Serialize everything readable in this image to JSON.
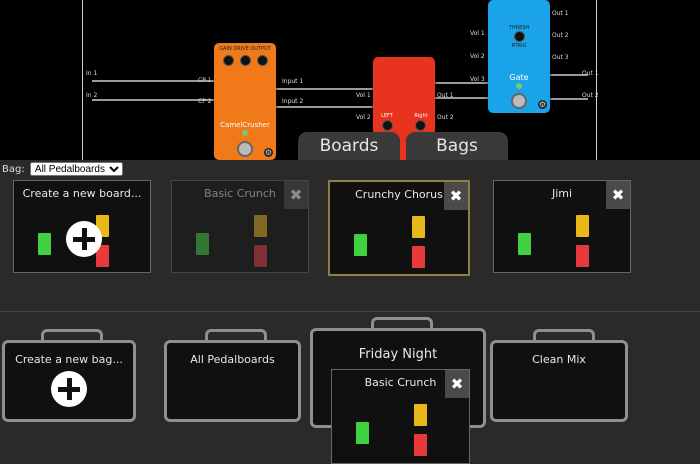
{
  "canvas": {
    "inputs_left": [
      "In 1",
      "In 2"
    ],
    "camel": {
      "knobs": [
        "GAIN",
        "DRIVE",
        "OUTPUT"
      ],
      "label": "CamelCrusher",
      "in_labels": [
        "CP 1",
        "CP 2"
      ],
      "out_labels": [
        "Input 1",
        "Input 2"
      ]
    },
    "red": {
      "knobs": [
        "LEFT",
        "Right"
      ],
      "in_labels": [
        "Vol 1",
        "Vol 2"
      ],
      "out_labels": [
        "Out 1",
        "Out 2"
      ]
    },
    "blue": {
      "label": "Gate",
      "knob_top": "THRESH",
      "knob_sub": "RTRIG",
      "left_labels": [
        "Vol 1",
        "Vol 2",
        "Vol 3"
      ],
      "right_labels": [
        "Out 1",
        "Out 2",
        "Out 3"
      ]
    },
    "outputs_right": [
      "Out 1",
      "Out 2"
    ]
  },
  "tabs": {
    "boards": "Boards",
    "bags": "Bags"
  },
  "bag_select": {
    "label": "Bag:",
    "value": "All Pedalboards"
  },
  "boards": [
    {
      "title": "Create a new board..."
    },
    {
      "title": "Basic Crunch"
    },
    {
      "title": "Crunchy Chorus"
    },
    {
      "title": "Jimi"
    }
  ],
  "bags": [
    {
      "title": "Create a new bag..."
    },
    {
      "title": "All Pedalboards"
    },
    {
      "title": "Friday Night"
    },
    {
      "title": "Clean Mix"
    }
  ],
  "bag_board": {
    "title": "Basic Crunch"
  },
  "icons": {
    "delete": "close-icon",
    "add": "plus-icon",
    "settings": "gear-icon"
  },
  "colors": {
    "orange": "#f07a1a",
    "red": "#e8331e",
    "blue": "#1aa3e8",
    "mini_green": "#3fd13f",
    "mini_yellow": "#e8b71a",
    "mini_red": "#e83a3a"
  }
}
